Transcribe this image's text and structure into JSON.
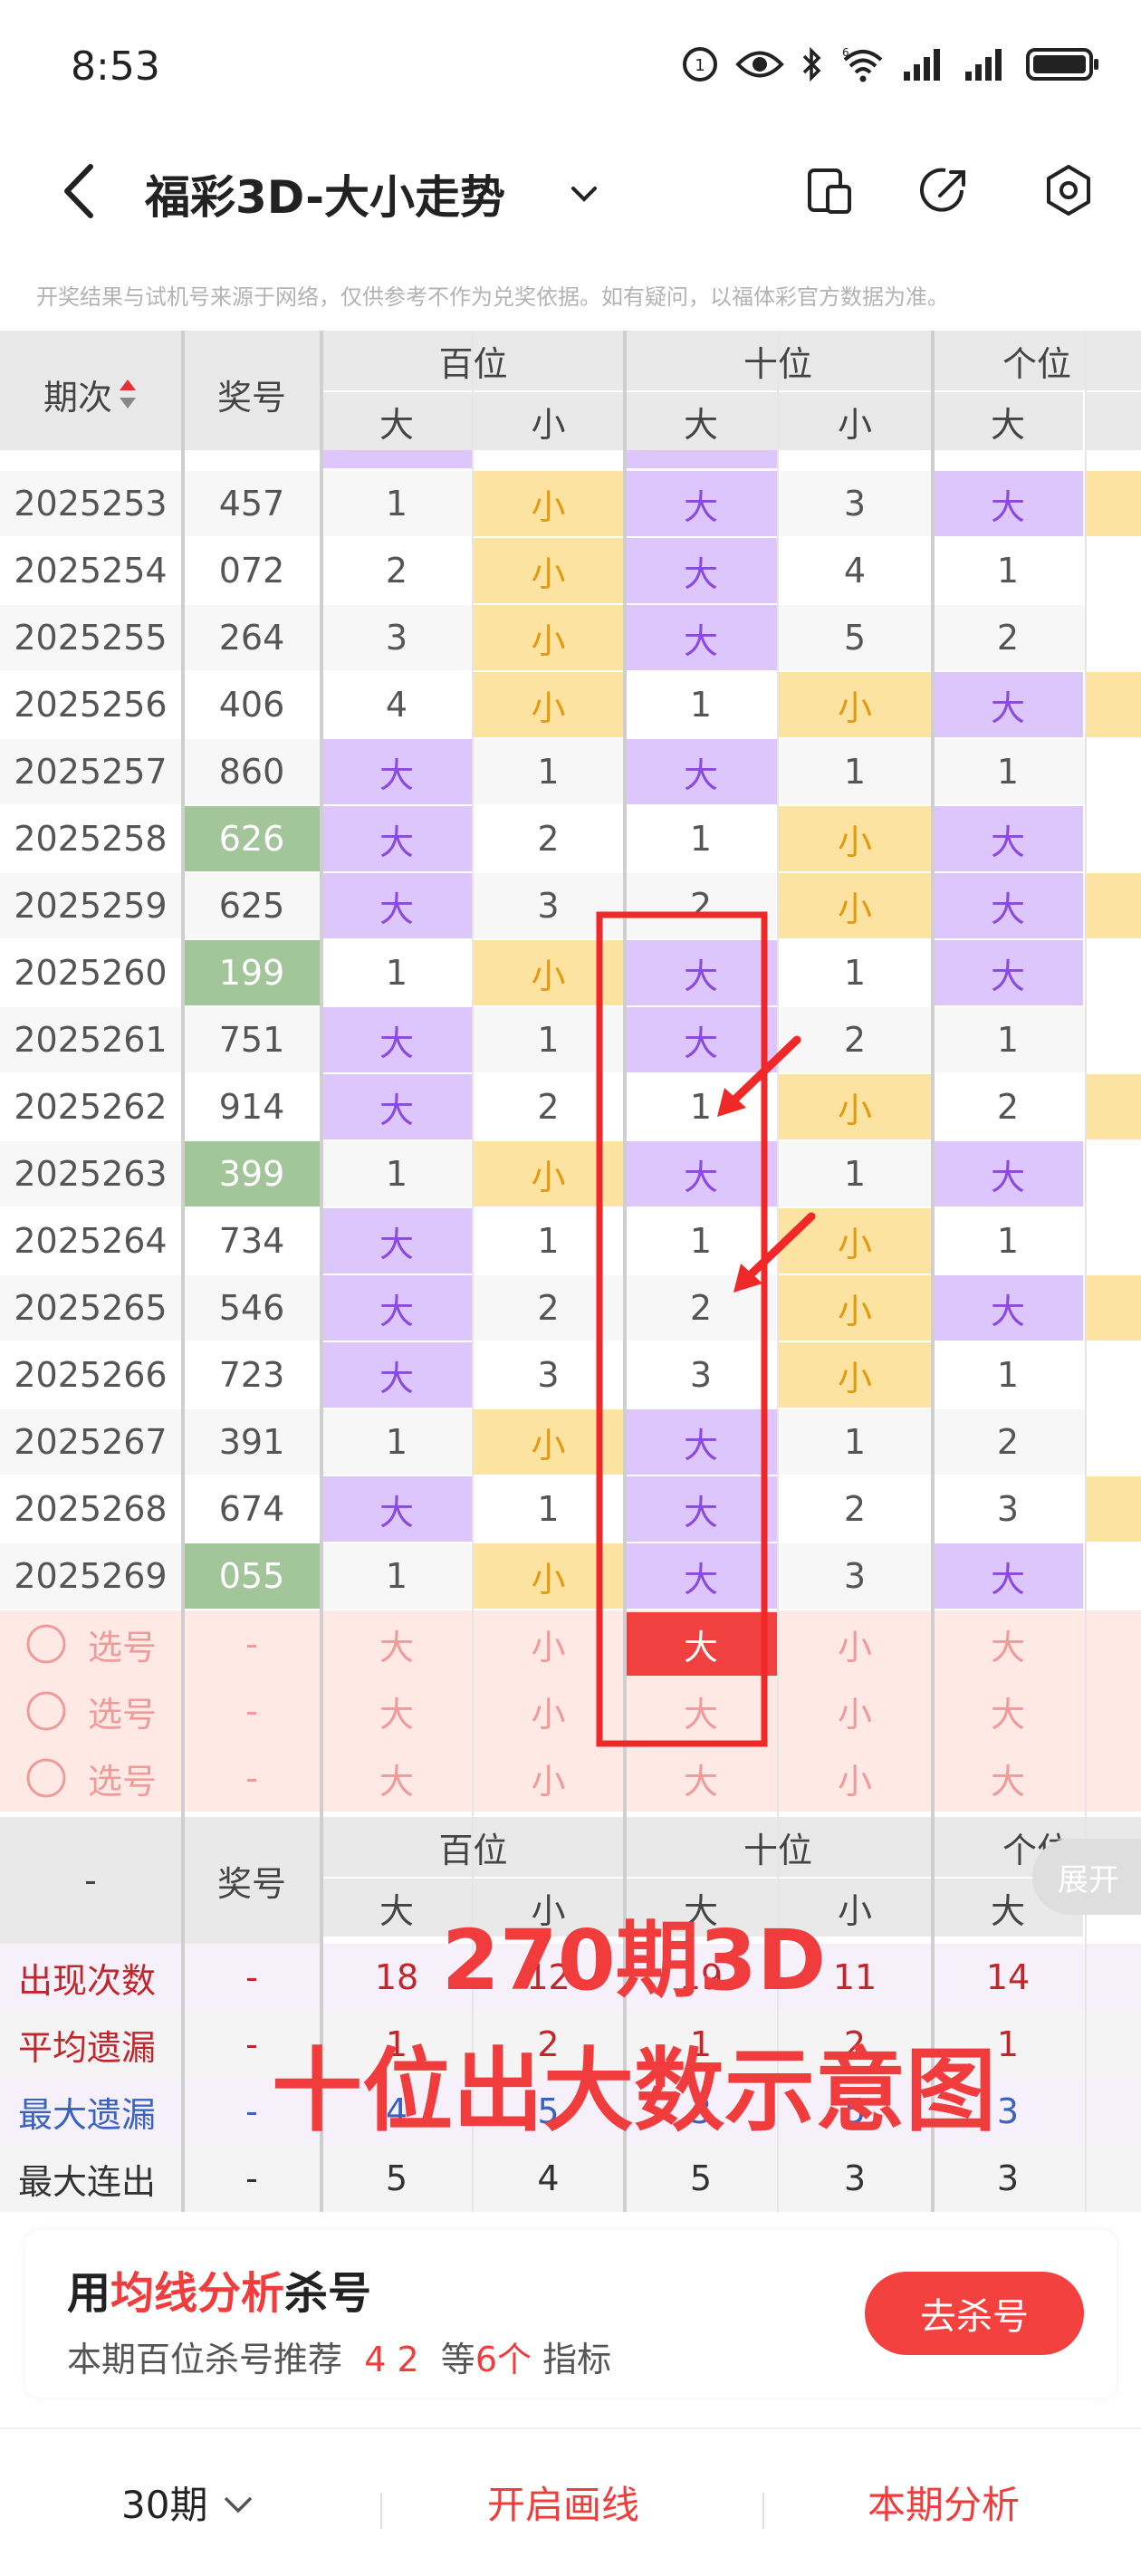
{
  "status": {
    "time": "8:53",
    "network": "6"
  },
  "nav": {
    "title": "福彩3D-大小走势"
  },
  "disclaimer": "开奖结果与试机号来源于网络，仅供参考不作为兑奖依据。如有疑问，以福体彩官方数据为准。",
  "table_header": {
    "period_label": "期次",
    "number_label": "奖号",
    "groups": [
      "百位",
      "十位",
      "个位"
    ],
    "sub": [
      "大",
      "小",
      "大",
      "小",
      "大"
    ]
  },
  "rows": [
    {
      "period": "2025253",
      "number": "457",
      "green": false,
      "cells": [
        "1",
        "小",
        "大",
        "3",
        "大"
      ]
    },
    {
      "period": "2025254",
      "number": "072",
      "green": false,
      "cells": [
        "2",
        "小",
        "大",
        "4",
        "1"
      ]
    },
    {
      "period": "2025255",
      "number": "264",
      "green": false,
      "cells": [
        "3",
        "小",
        "大",
        "5",
        "2"
      ]
    },
    {
      "period": "2025256",
      "number": "406",
      "green": false,
      "cells": [
        "4",
        "小",
        "1",
        "小",
        "大"
      ]
    },
    {
      "period": "2025257",
      "number": "860",
      "green": false,
      "cells": [
        "大",
        "1",
        "大",
        "1",
        "1"
      ]
    },
    {
      "period": "2025258",
      "number": "626",
      "green": true,
      "cells": [
        "大",
        "2",
        "1",
        "小",
        "大"
      ]
    },
    {
      "period": "2025259",
      "number": "625",
      "green": false,
      "cells": [
        "大",
        "3",
        "2",
        "小",
        "大"
      ]
    },
    {
      "period": "2025260",
      "number": "199",
      "green": true,
      "cells": [
        "1",
        "小",
        "大",
        "1",
        "大"
      ]
    },
    {
      "period": "2025261",
      "number": "751",
      "green": false,
      "cells": [
        "大",
        "1",
        "大",
        "2",
        "1"
      ]
    },
    {
      "period": "2025262",
      "number": "914",
      "green": false,
      "cells": [
        "大",
        "2",
        "1",
        "小",
        "2"
      ]
    },
    {
      "period": "2025263",
      "number": "399",
      "green": true,
      "cells": [
        "1",
        "小",
        "大",
        "1",
        "大"
      ]
    },
    {
      "period": "2025264",
      "number": "734",
      "green": false,
      "cells": [
        "大",
        "1",
        "1",
        "小",
        "1"
      ]
    },
    {
      "period": "2025265",
      "number": "546",
      "green": false,
      "cells": [
        "大",
        "2",
        "2",
        "小",
        "大"
      ]
    },
    {
      "period": "2025266",
      "number": "723",
      "green": false,
      "cells": [
        "大",
        "3",
        "3",
        "小",
        "1"
      ]
    },
    {
      "period": "2025267",
      "number": "391",
      "green": false,
      "cells": [
        "1",
        "小",
        "大",
        "1",
        "2"
      ]
    },
    {
      "period": "2025268",
      "number": "674",
      "green": false,
      "cells": [
        "大",
        "1",
        "大",
        "2",
        "3"
      ]
    },
    {
      "period": "2025269",
      "number": "055",
      "green": true,
      "cells": [
        "1",
        "小",
        "大",
        "3",
        "大"
      ]
    }
  ],
  "pick_rows": [
    {
      "label": "选号",
      "number": "-",
      "cells": [
        "大",
        "小",
        "大",
        "小",
        "大"
      ],
      "selected_index": 2
    },
    {
      "label": "选号",
      "number": "-",
      "cells": [
        "大",
        "小",
        "大",
        "小",
        "大"
      ],
      "selected_index": -1
    },
    {
      "label": "选号",
      "number": "-",
      "cells": [
        "大",
        "小",
        "大",
        "小",
        "大"
      ],
      "selected_index": -1
    }
  ],
  "stats_header": {
    "dash": "-",
    "number_label": "奖号",
    "groups": [
      "百位",
      "十位",
      "个位"
    ],
    "sub": [
      "大",
      "小",
      "大",
      "小",
      "大"
    ]
  },
  "stats": [
    {
      "label": "出现次数",
      "color": "#c0262b",
      "values": [
        "-",
        "18",
        "12",
        "19",
        "11",
        "14"
      ]
    },
    {
      "label": "平均遗漏",
      "color": "#c0262b",
      "values": [
        "-",
        "1",
        "2",
        "1",
        "2",
        "1"
      ]
    },
    {
      "label": "最大遗漏",
      "color": "#3a63c0",
      "values": [
        "-",
        "4",
        "5",
        "3",
        "5",
        "3"
      ]
    },
    {
      "label": "最大连出",
      "color": "#333333",
      "values": [
        "-",
        "5",
        "4",
        "5",
        "3",
        "3"
      ]
    }
  ],
  "overlay": {
    "line1": "270期3D",
    "line2": "十位出大数示意图"
  },
  "expand_label": "展开",
  "banner": {
    "prefix": "用",
    "highlight": "均线分析",
    "suffix": "杀号",
    "sub_prefix": "本期百位杀号推荐",
    "kill_numbers": "4 2",
    "sub_mid": "等",
    "count": "6个",
    "sub_suffix": "指标",
    "button": "去杀号"
  },
  "bottom": {
    "periods": "30期",
    "draw_line": "开启画线",
    "analysis": "本期分析"
  },
  "colors": {
    "accent": "#f03c3c",
    "big": "#ddc6fb",
    "small": "#fde3a2",
    "green": "#a3c59a"
  }
}
